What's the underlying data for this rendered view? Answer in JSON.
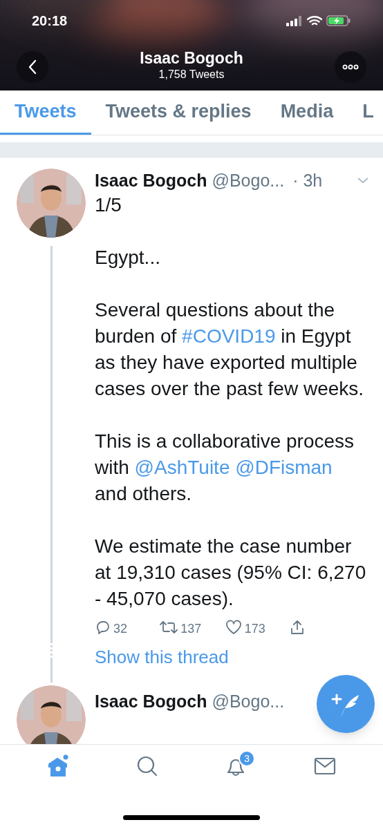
{
  "status_bar": {
    "time": "20:18"
  },
  "header": {
    "title": "Isaac Bogoch",
    "subtitle": "1,758 Tweets"
  },
  "tabs": [
    {
      "label": "Tweets",
      "selected": true
    },
    {
      "label": "Tweets & replies",
      "selected": false
    },
    {
      "label": "Media",
      "selected": false
    },
    {
      "label": "L",
      "selected": false
    }
  ],
  "tweets": [
    {
      "name": "Isaac Bogoch",
      "handle": "@Bogo...",
      "time": "· 3h",
      "paragraphs": [
        [
          {
            "kind": "text",
            "text": "1/5"
          }
        ],
        [
          {
            "kind": "text",
            "text": "Egypt..."
          }
        ],
        [
          {
            "kind": "text",
            "text": "Several questions about the burden of "
          },
          {
            "kind": "hashtag",
            "text": "#COVID19"
          },
          {
            "kind": "text",
            "text": " in Egypt as they have exported multiple cases over the past few weeks."
          }
        ],
        [
          {
            "kind": "text",
            "text": "This is a collaborative process with "
          },
          {
            "kind": "mention",
            "text": "@AshTuite"
          },
          {
            "kind": "space"
          },
          {
            "kind": "mention",
            "text": "@DFisman"
          },
          {
            "kind": "text",
            "text": " and others."
          }
        ],
        [
          {
            "kind": "text",
            "text": "We estimate the case number at 19,310 cases (95% CI: 6,270 - 45,070 cases)."
          }
        ]
      ],
      "actions": [
        {
          "kind": "reply",
          "count": "32"
        },
        {
          "kind": "retweet",
          "count": "137"
        },
        {
          "kind": "like",
          "count": "173"
        },
        {
          "kind": "share"
        }
      ],
      "thread_link": "Show this thread"
    },
    {
      "name": "Isaac Bogoch",
      "handle": "@Bogo..."
    }
  ],
  "nav": [
    {
      "kind": "home",
      "selected": true
    },
    {
      "kind": "search",
      "selected": false
    },
    {
      "kind": "notifications",
      "selected": false,
      "badge": "3"
    },
    {
      "kind": "messages",
      "selected": false
    }
  ]
}
